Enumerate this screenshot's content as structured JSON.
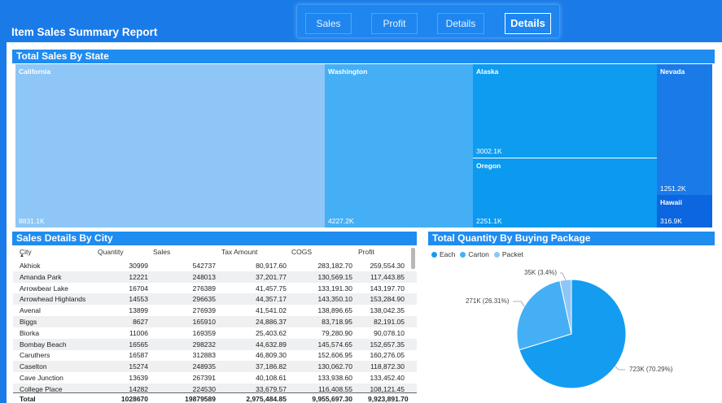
{
  "nav": {
    "buttons": [
      {
        "label": "Sales"
      },
      {
        "label": "Profit"
      },
      {
        "label": "Details"
      },
      {
        "label": "Details"
      }
    ]
  },
  "report_title": "Item Sales Summary Report",
  "treemap": {
    "title": "Total Sales By State",
    "tiles": [
      {
        "name": "California",
        "value": "8831.1K",
        "color": "#8dc6f7"
      },
      {
        "name": "Washington",
        "value": "4227.2K",
        "color": "#45aff5"
      },
      {
        "name": "Alaska",
        "value": "3002.1K",
        "color": "#0e9cf0"
      },
      {
        "name": "Oregon",
        "value": "2251.1K",
        "color": "#0b9aef"
      },
      {
        "name": "Nevada",
        "value": "1251.2K",
        "color": "#1a7be8"
      },
      {
        "name": "Hawaii",
        "value": "316.9K",
        "color": "#0b66e0"
      }
    ]
  },
  "table": {
    "title": "Sales Details By City",
    "columns": [
      "City",
      "Quantity",
      "Sales",
      "Tax Amount",
      "COGS",
      "Profit"
    ],
    "sort_indicator": "▲",
    "rows": [
      [
        "Akhiok",
        "30999",
        "542737",
        "80,917.60",
        "283,182.70",
        "259,554.30"
      ],
      [
        "Amanda Park",
        "12221",
        "248013",
        "37,201.77",
        "130,569.15",
        "117,443.85"
      ],
      [
        "Arrowbear Lake",
        "16704",
        "276389",
        "41,457.75",
        "133,191.30",
        "143,197.70"
      ],
      [
        "Arrowhead Highlands",
        "14553",
        "296635",
        "44,357.17",
        "143,350.10",
        "153,284.90"
      ],
      [
        "Avenal",
        "13899",
        "276939",
        "41,541.02",
        "138,896.65",
        "138,042.35"
      ],
      [
        "Biggs",
        "8627",
        "165910",
        "24,886.37",
        "83,718.95",
        "82,191.05"
      ],
      [
        "Biorka",
        "11006",
        "169359",
        "25,403.62",
        "79,280.90",
        "90,078.10"
      ],
      [
        "Bombay Beach",
        "16565",
        "298232",
        "44,632.89",
        "145,574.65",
        "152,657.35"
      ],
      [
        "Caruthers",
        "16587",
        "312883",
        "46,809.30",
        "152,606.95",
        "160,276.05"
      ],
      [
        "Caselton",
        "15274",
        "248935",
        "37,186.82",
        "130,062.70",
        "118,872.30"
      ],
      [
        "Cave Junction",
        "13639",
        "267391",
        "40,108.61",
        "133,938.60",
        "133,452.40"
      ],
      [
        "College Place",
        "14282",
        "224530",
        "33,679.57",
        "116,408.55",
        "108,121.45"
      ]
    ],
    "total": [
      "Total",
      "1028670",
      "19879589",
      "2,975,484.85",
      "9,955,697.30",
      "9,923,891.70"
    ]
  },
  "pie": {
    "title": "Total Quantity By Buying Package",
    "chart_data": {
      "type": "pie",
      "title": "Total Quantity By Buying Package",
      "categories": [
        "Each",
        "Carton",
        "Packet"
      ],
      "values": [
        723,
        271,
        35
      ],
      "unit": "K",
      "percents": [
        70.29,
        26.31,
        3.4
      ],
      "labels": [
        "723K (70.29%)",
        "271K (26.31%)",
        "35K (3.4%)"
      ],
      "colors": [
        "#149cf0",
        "#45aff5",
        "#8dc6f7"
      ],
      "legend": "top-left"
    }
  }
}
